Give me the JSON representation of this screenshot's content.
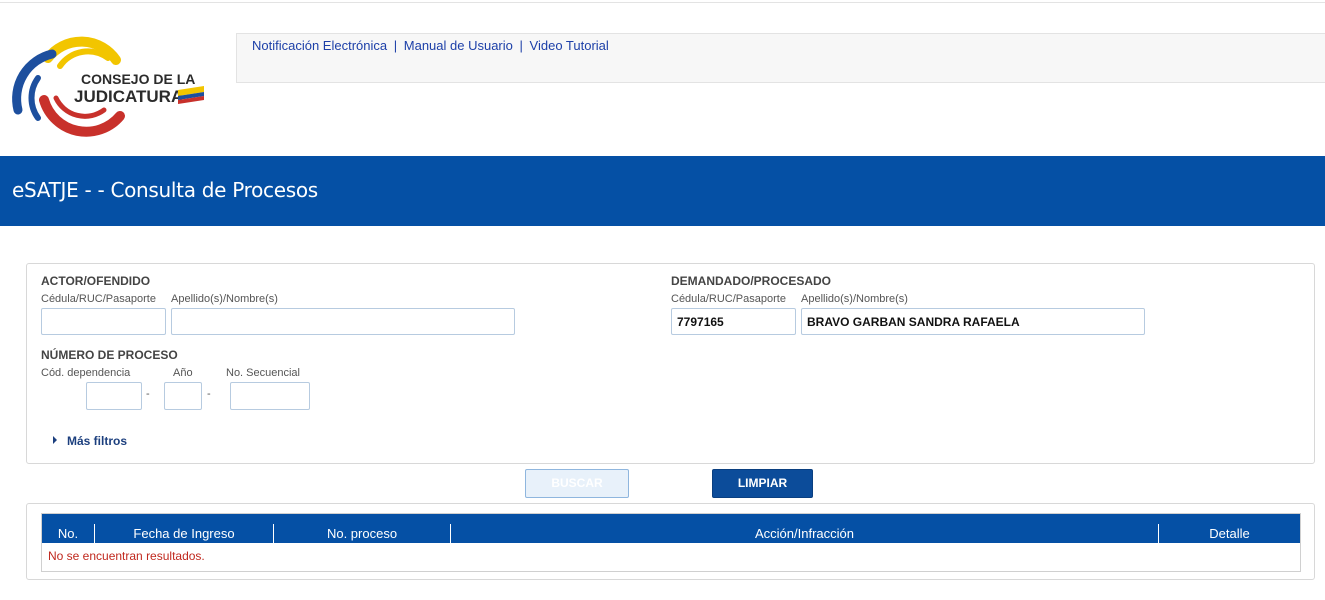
{
  "header": {
    "logo_text_line1": "CONSEJO DE LA",
    "logo_text_line2": "JUDICATURA",
    "links": [
      "Notificación Electrónica",
      "Manual de Usuario",
      "Video Tutorial"
    ],
    "link_separator": "|"
  },
  "banner": {
    "title": "eSATJE - - Consulta de Procesos"
  },
  "colors": {
    "brand_blue": "#0550a5",
    "button_blue": "#0c4c9a",
    "error_red": "#c0281e",
    "logo_yellow": "#f2c500",
    "logo_red": "#c8312b"
  },
  "actor": {
    "title": "ACTOR/OFENDIDO",
    "id_label": "Cédula/RUC/Pasaporte",
    "name_label": "Apellido(s)/Nombre(s)",
    "id_value": "",
    "name_value": ""
  },
  "demandado": {
    "title": "DEMANDADO/PROCESADO",
    "id_label": "Cédula/RUC/Pasaporte",
    "name_label": "Apellido(s)/Nombre(s)",
    "id_value": "7797165",
    "name_value": "BRAVO GARBAN SANDRA RAFAELA"
  },
  "proceso": {
    "title": "NÚMERO DE PROCESO",
    "dep_label": "Cód. dependencia",
    "anio_label": "Año",
    "sec_label": "No. Secuencial",
    "dash": "-"
  },
  "more_filters": "Más filtros",
  "buttons": {
    "search": "BUSCAR",
    "clear": "LIMPIAR"
  },
  "table": {
    "columns": [
      "No.",
      "Fecha de Ingreso",
      "No. proceso",
      "Acción/Infracción",
      "Detalle"
    ],
    "empty_message": "No se encuentran resultados."
  }
}
